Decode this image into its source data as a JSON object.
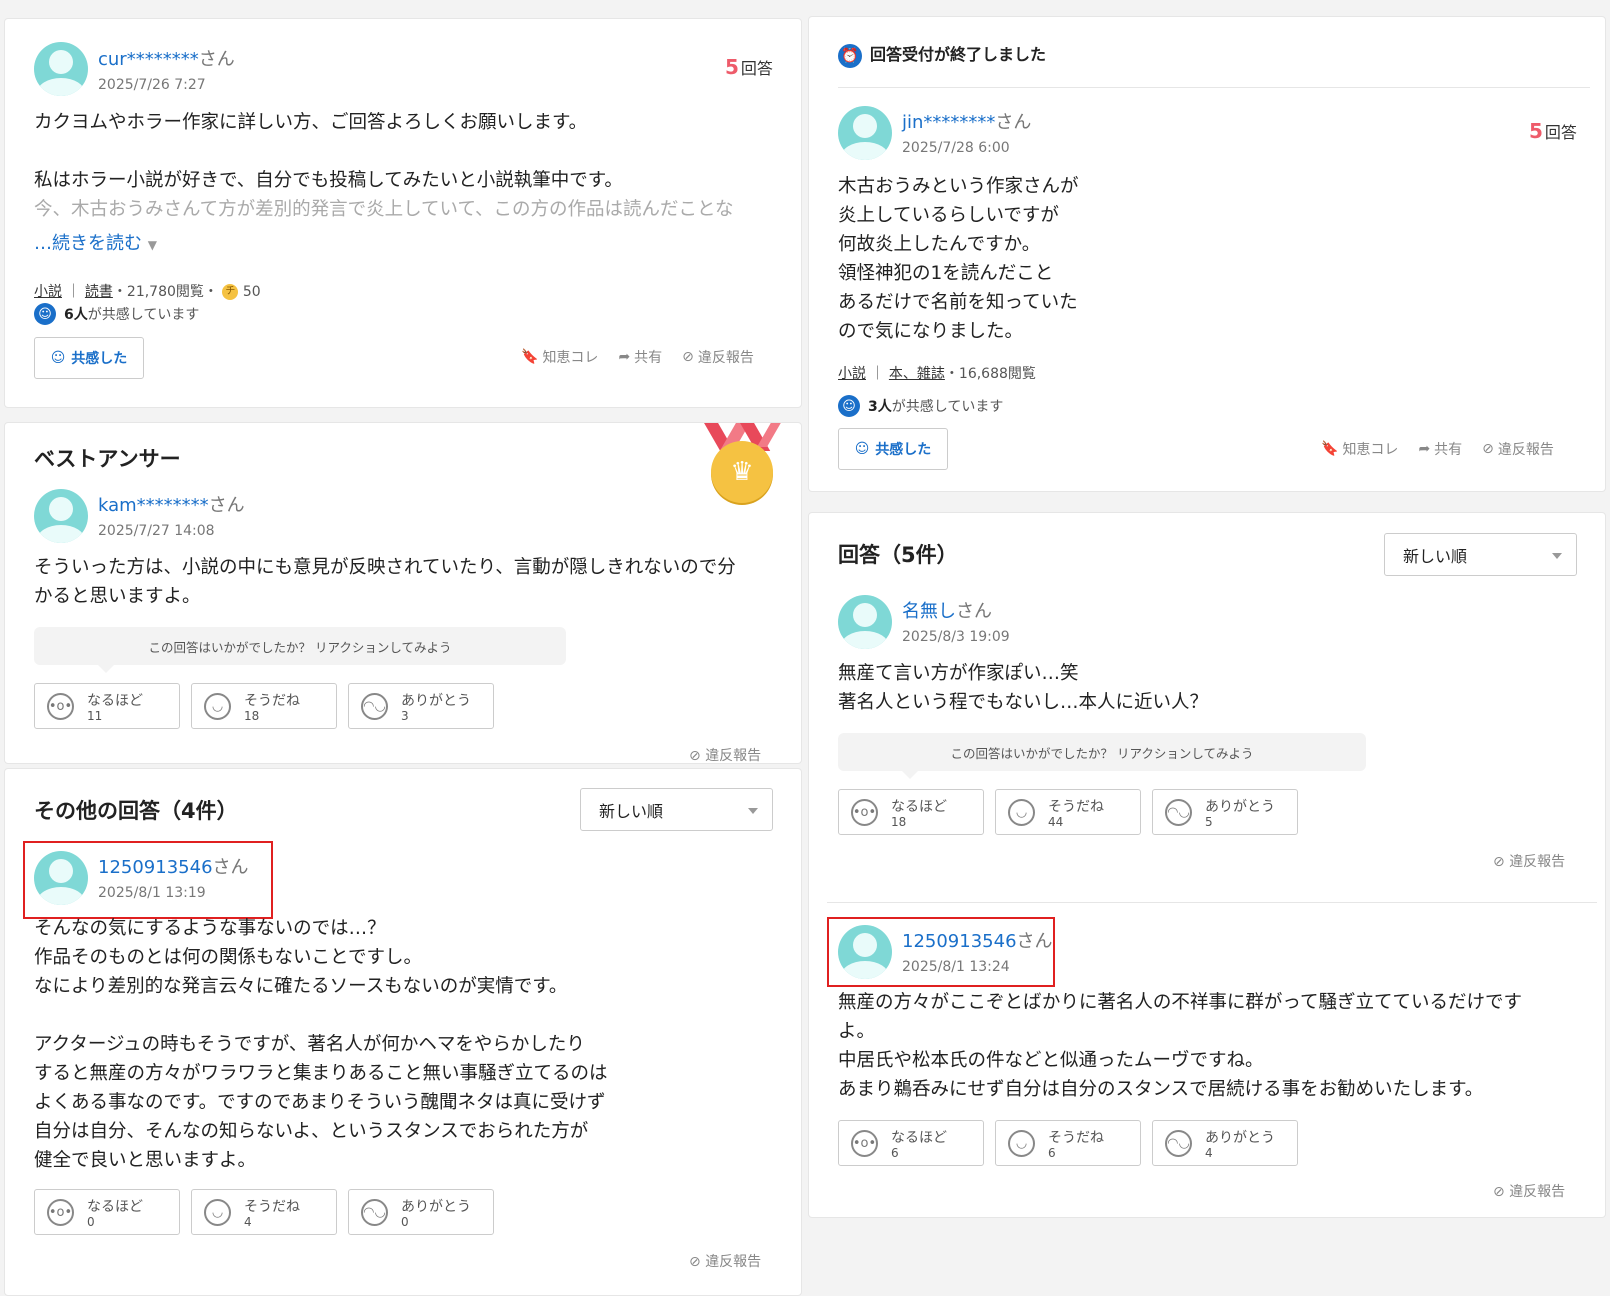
{
  "question_left": {
    "user": "cur********",
    "san": "さん",
    "date": "2025/7/26 7:27",
    "answer_count": "5",
    "answer_count_label": "回答",
    "body": "カクヨムやホラー作家に詳しい方、ご回答よろしくお願いします。\n\n私はホラー小説が好きで、自分でも投稿してみたいと小説執筆中です。",
    "faded_line": "今、木古おうみさんて方が差別的発言で炎上していて、この方の作品は読んだことな",
    "read_more": "…続きを読む",
    "category1": "小説",
    "category2": "読書",
    "views": "・21,780閲覧・",
    "coins": "50",
    "empathy_count": "6人",
    "empathy_text": "が共感しています",
    "empathy_button": "共感した",
    "bookmark": "知恵コレ",
    "share": "共有",
    "report": "違反報告"
  },
  "best_answer": {
    "heading": "ベストアンサー",
    "user": "kam********",
    "san": "さん",
    "date": "2025/7/27 14:08",
    "body": "そういった方は、小説の中にも意見が反映されていたり、言動が隠しきれないので分\nかると思いますよ。",
    "prompt": "この回答はいかがでしたか？ リアクションしてみよう",
    "reactions": [
      {
        "label": "なるほど",
        "count": "11"
      },
      {
        "label": "そうだね",
        "count": "18"
      },
      {
        "label": "ありがとう",
        "count": "3"
      }
    ],
    "report": "違反報告"
  },
  "other_answers": {
    "heading": "その他の回答（4件）",
    "sort": "新しい順",
    "user": "1250913546",
    "san": "さん",
    "date": "2025/8/1 13:19",
    "body": "そんなの気にするような事ないのでは…？\n作品そのものとは何の関係もないことですし。\nなにより差別的な発言云々に確たるソースもないのが実情です。\n\nアクタージュの時もそうですが、著名人が何かヘマをやらかしたり\nすると無産の方々がワラワラと集まりあること無い事騒ぎ立てるのは\nよくある事なのです。ですのであまりそういう醜聞ネタは真に受けず\n自分は自分、そんなの知らないよ、というスタンスでおられた方が\n健全で良いと思いますよ。",
    "reactions": [
      {
        "label": "なるほど",
        "count": "0"
      },
      {
        "label": "そうだね",
        "count": "4"
      },
      {
        "label": "ありがとう",
        "count": "0"
      }
    ],
    "report": "違反報告"
  },
  "question_right": {
    "closed_notice": "回答受付が終了しました",
    "user": "jin********",
    "san": "さん",
    "date": "2025/7/28 6:00",
    "answer_count": "5",
    "answer_count_label": "回答",
    "body": "木古おうみという作家さんが\n炎上しているらしいですが\n何故炎上したんですか。\n領怪神犯の1を読んだこと\nあるだけで名前を知っていた\nので気になりました。",
    "category1": "小説",
    "category2": "本、雑誌",
    "views": "・16,688閲覧",
    "empathy_count": "3人",
    "empathy_text": "が共感しています",
    "empathy_button": "共感した",
    "bookmark": "知恵コレ",
    "share": "共有",
    "report": "違反報告"
  },
  "answers_right": {
    "heading": "回答（5件）",
    "sort": "新しい順",
    "answer1": {
      "user": "名無し",
      "san": "さん",
      "date": "2025/8/3 19:09",
      "body": "無産て言い方が作家ぽい…笑\n著名人という程でもないし…本人に近い人？",
      "prompt": "この回答はいかがでしたか？ リアクションしてみよう",
      "reactions": [
        {
          "label": "なるほど",
          "count": "18"
        },
        {
          "label": "そうだね",
          "count": "44"
        },
        {
          "label": "ありがとう",
          "count": "5"
        }
      ],
      "report": "違反報告"
    },
    "answer2": {
      "user": "1250913546",
      "san": "さん",
      "date": "2025/8/1 13:24",
      "body": "無産の方々がここぞとばかりに著名人の不祥事に群がって騒ぎ立てているだけです\nよ。\n中居氏や松本氏の件などと似通ったムーヴですね。\nあまり鵜呑みにせず自分は自分のスタンスで居続ける事をお勧めいたします。",
      "reactions": [
        {
          "label": "なるほど",
          "count": "6"
        },
        {
          "label": "そうだね",
          "count": "6"
        },
        {
          "label": "ありがとう",
          "count": "4"
        }
      ],
      "report": "違反報告"
    }
  },
  "colors": {
    "link": "#1a6fc9",
    "count_red": "#ee5b6a",
    "highlight": "#e02020",
    "medal": "#f5c242"
  }
}
